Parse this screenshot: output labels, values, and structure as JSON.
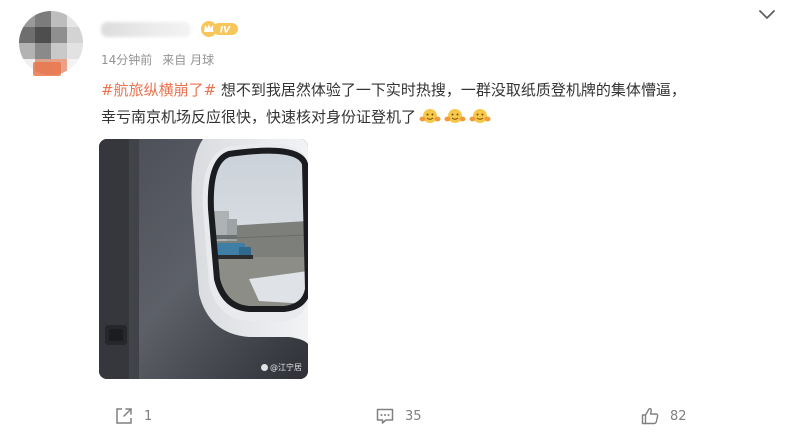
{
  "post": {
    "meta": {
      "time": "14分钟前",
      "source": "来自 月球"
    },
    "vip_badge": "IV",
    "content": {
      "hashtag": "#航旅纵横崩了#",
      "line1_text": " 想不到我居然体验了一下实时热搜，一群没取纸质登机牌的集体懵逼，",
      "line2_text": "幸亏南京机场反应很快，快速核对身份证登机了",
      "emoji": "hug-emoji"
    },
    "image": {
      "watermark": "@江宁居"
    },
    "actions": {
      "repost_count": "1",
      "comment_count": "35",
      "like_count": "82"
    }
  },
  "colors": {
    "hashtag": "#eb7350",
    "meta_text": "#939393",
    "action_text": "#808080",
    "vip_badge_bg": "#f6c65b"
  },
  "icons": [
    "chevron-down-icon",
    "repost-icon",
    "comment-icon",
    "like-icon",
    "vip-crown-icon",
    "hug-emoji-icon"
  ]
}
